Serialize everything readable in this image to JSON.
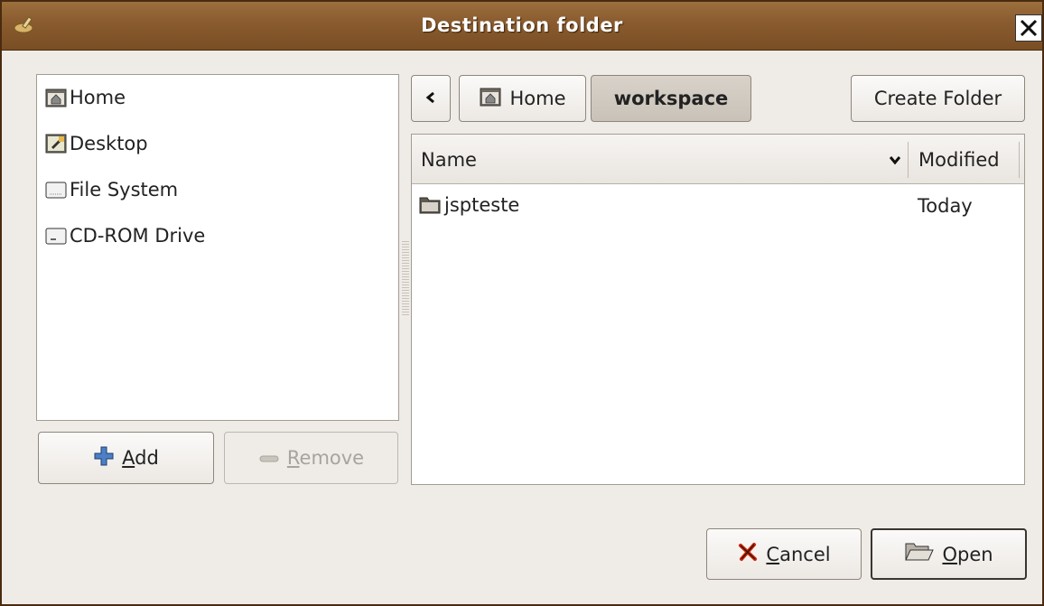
{
  "window": {
    "title": "Destination folder"
  },
  "places": [
    {
      "label": "Home",
      "icon": "home-folder-icon"
    },
    {
      "label": "Desktop",
      "icon": "desktop-icon"
    },
    {
      "label": "File System",
      "icon": "harddrive-icon"
    },
    {
      "label": "CD-ROM Drive",
      "icon": "cdrom-drive-icon"
    }
  ],
  "path_bar": {
    "home_label": "Home",
    "current_label": "workspace",
    "create_folder_label": "Create Folder"
  },
  "file_list": {
    "columns": {
      "name": "Name",
      "modified": "Modified"
    },
    "rows": [
      {
        "name": "jspteste",
        "modified": "Today"
      }
    ]
  },
  "buttons": {
    "add": {
      "mnemonic": "A",
      "rest": "dd"
    },
    "remove": {
      "mnemonic": "R",
      "rest": "emove"
    },
    "cancel": {
      "mnemonic": "C",
      "rest": "ancel"
    },
    "open": {
      "mnemonic": "O",
      "rest": "pen"
    }
  },
  "colors": {
    "titlebar": "#8a5c2f",
    "window_bg": "#efebe7",
    "accent_cancel": "#cc2200"
  }
}
